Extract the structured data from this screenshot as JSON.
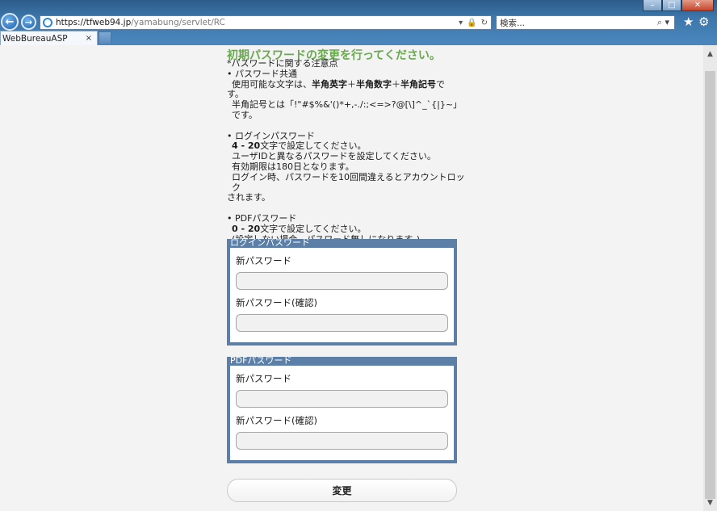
{
  "browser": {
    "url_host": "https://tfweb94.jp",
    "url_path": "/yamabung/servlet/RC",
    "search_placeholder": "検索...",
    "tab_title": "WebBureauASP",
    "tab_close": "×",
    "window_controls": {
      "minimize": "–",
      "maximize": "□",
      "close": "✕"
    }
  },
  "page": {
    "title": "初期パスワードの変更を行ってください。",
    "notes": {
      "header": "*パスワードに関する注意点",
      "common": {
        "bullet": "• パスワード共通",
        "line1_pre": "使用可能な文字は、",
        "line1_alpha": "半角英字",
        "plus1": "＋",
        "line1_num": "半角数字",
        "plus2": "＋",
        "line1_sym": "半角記号",
        "line1_post": "で",
        "line2": "す。",
        "line3": "半角記号とは「!\"#$%&'()*+,-./:;<=>?@[\\]^_`{|}~」です。"
      },
      "login": {
        "bullet": "• ログインパスワード",
        "range": "4 - 20",
        "range_suffix": "文字で設定してください。",
        "line2": "ユーザIDと異なるパスワードを設定してください。",
        "line3": "有効期限は180日となります。",
        "line4": "ログイン時、パスワードを10回間違えるとアカウントロック",
        "line5": "されます。"
      },
      "pdf": {
        "bullet": "• PDFパスワード",
        "range": "0 - 20",
        "range_suffix": "文字で設定してください。",
        "line2": "(設定しない場合、パスワード無しになります。)"
      }
    },
    "login_panel": {
      "header": "ログインパスワード",
      "new_label": "新パスワード",
      "confirm_label": "新パスワード(確認)",
      "new_value": "",
      "confirm_value": ""
    },
    "pdf_panel": {
      "header": "PDFパスワード",
      "new_label": "新パスワード",
      "confirm_label": "新パスワード(確認)",
      "new_value": "",
      "confirm_value": ""
    },
    "submit_label": "変更"
  },
  "icons": [
    "back-arrow-icon",
    "forward-arrow-icon",
    "ie-logo-icon",
    "lock-icon",
    "refresh-icon",
    "search-icon",
    "star-icon",
    "gear-icon",
    "close-icon"
  ],
  "colors": {
    "title_green": "#6aa84f",
    "panel_blue": "#5b7fa6"
  }
}
